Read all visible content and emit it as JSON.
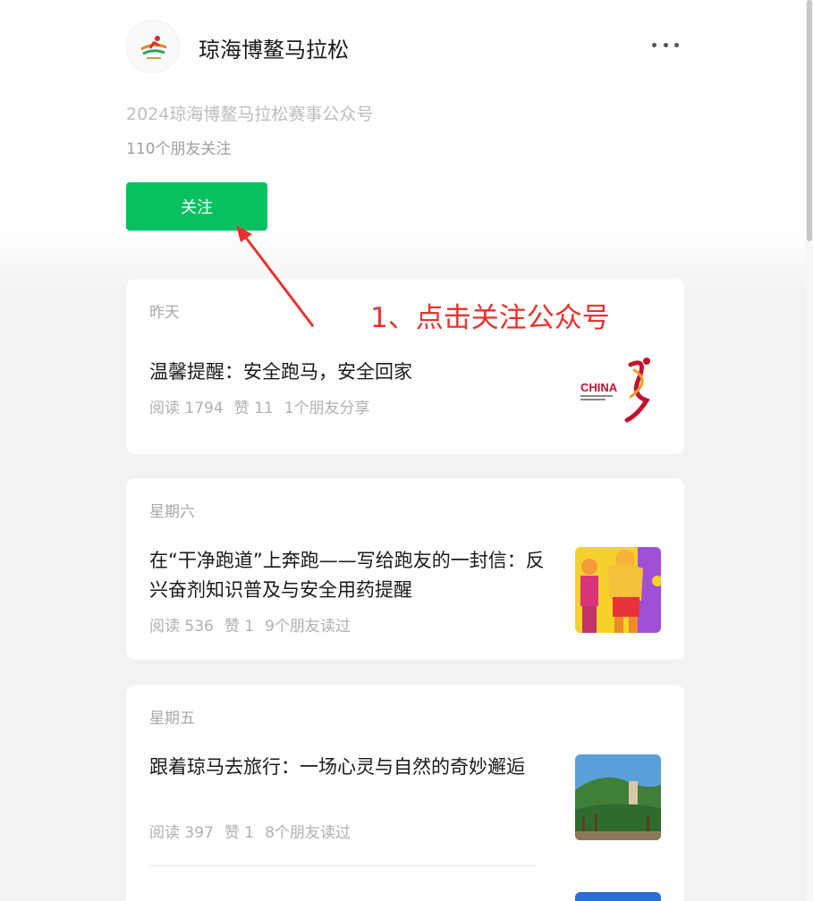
{
  "account": {
    "name": "琼海博鳌马拉松",
    "description": "2024琼海博鳌马拉松赛事公众号",
    "friends_following": "110个朋友关注",
    "follow_label": "关注",
    "more_icon": "more-dots-icon"
  },
  "annotation": {
    "text": "1、点击关注公众号",
    "color": "#e8322e"
  },
  "articles": [
    {
      "day": "昨天",
      "title": "温馨提醒：安全跑马，安全回家",
      "reads": "阅读 1794",
      "likes": "赞 11",
      "social": "1个朋友分享",
      "thumb_logo_text": "CHINA"
    },
    {
      "day": "星期六",
      "title": "在“干净跑道”上奔跑——写给跑友的一封信：反兴奋剂知识普及与安全用药提醒",
      "reads": "阅读 536",
      "likes": "赞 1",
      "social": "9个朋友读过"
    },
    {
      "day": "星期五",
      "title": "跟着琼马去旅行：一场心灵与自然的奇妙邂逅",
      "reads": "阅读 397",
      "likes": "赞 1",
      "social": "8个朋友读过"
    }
  ],
  "colors": {
    "accent": "#07c160",
    "annotation": "#e8322e"
  }
}
